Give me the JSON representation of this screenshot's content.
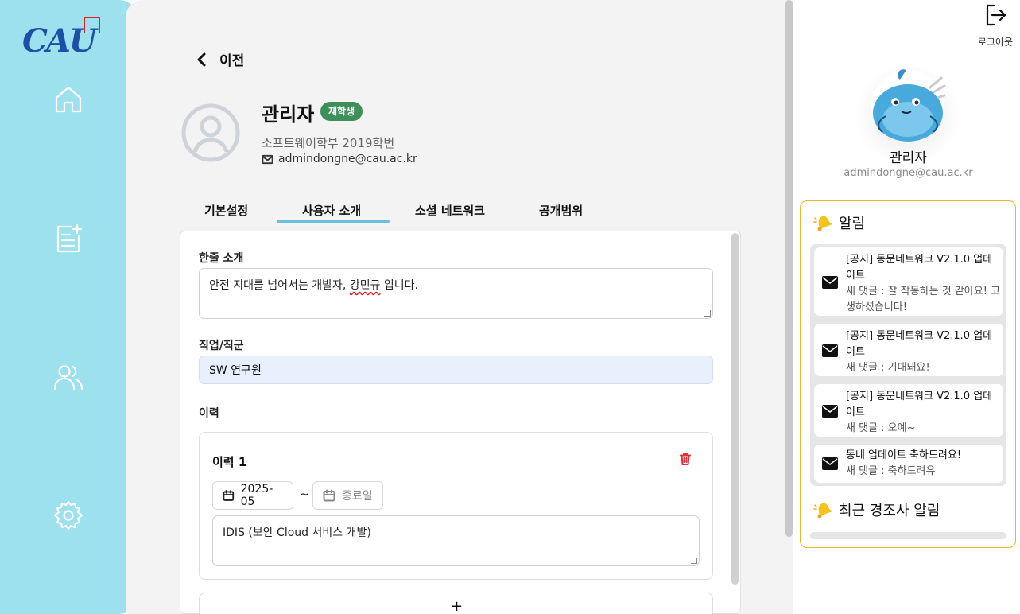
{
  "sidebar": {
    "logo_text": "CAU",
    "items": [
      {
        "name": "home-icon"
      },
      {
        "name": "post-add-icon"
      },
      {
        "name": "users-icon"
      },
      {
        "name": "settings-icon"
      }
    ]
  },
  "header": {
    "back_label": "이전"
  },
  "profile": {
    "name": "관리자",
    "status_badge": "재학생",
    "department": "소프트웨어학부 2019학번",
    "email": "admindongne@cau.ac.kr"
  },
  "tabs": [
    {
      "label": "기본설정",
      "active": false
    },
    {
      "label": "사용자 소개",
      "active": true
    },
    {
      "label": "소셜 네트워크",
      "active": false
    },
    {
      "label": "공개범위",
      "active": false
    }
  ],
  "form": {
    "intro_label": "한줄 소개",
    "intro_value_prefix": "안전 지대를 넘어서는 개발자, ",
    "intro_value_name": "강민규",
    "intro_value_suffix": " 입니다.",
    "job_label": "직업/직군",
    "job_value": "SW 연구원",
    "career_label": "이력",
    "career": {
      "title": "이력 1",
      "start_date": "2025-05",
      "separator": "~",
      "end_placeholder": "종료일",
      "description": "IDIS (보안 Cloud 서비스 개발)"
    },
    "add_symbol": "+"
  },
  "right_panel": {
    "logout_label": "로그아웃",
    "user_name": "관리자",
    "user_email": "admindongne@cau.ac.kr",
    "notifications_title": "알림",
    "notifications": [
      {
        "title": "[공지] 동문네트워크 V2.1.0 업데이트",
        "comment": "새 댓글 : 잘 작동하는 것 같아요! 고생하셨습니다!"
      },
      {
        "title": "[공지] 동문네트워크 V2.1.0 업데이트",
        "comment": "새 댓글 : 기대돼요!"
      },
      {
        "title": "[공지] 동문네트워크 V2.1.0 업데이트",
        "comment": "새 댓글 : 오예~"
      },
      {
        "title": "동네 업데이트 축하드려요!",
        "comment": "새 댓글 : 축하드려유"
      }
    ],
    "recent_title": "최근 경조사 알림"
  },
  "colors": {
    "sidebar": "#9de0ee",
    "badge": "#3f8f5a",
    "tab_underline": "#6cc0dc",
    "notification_border": "#f0b429",
    "delete": "#e0303a"
  }
}
